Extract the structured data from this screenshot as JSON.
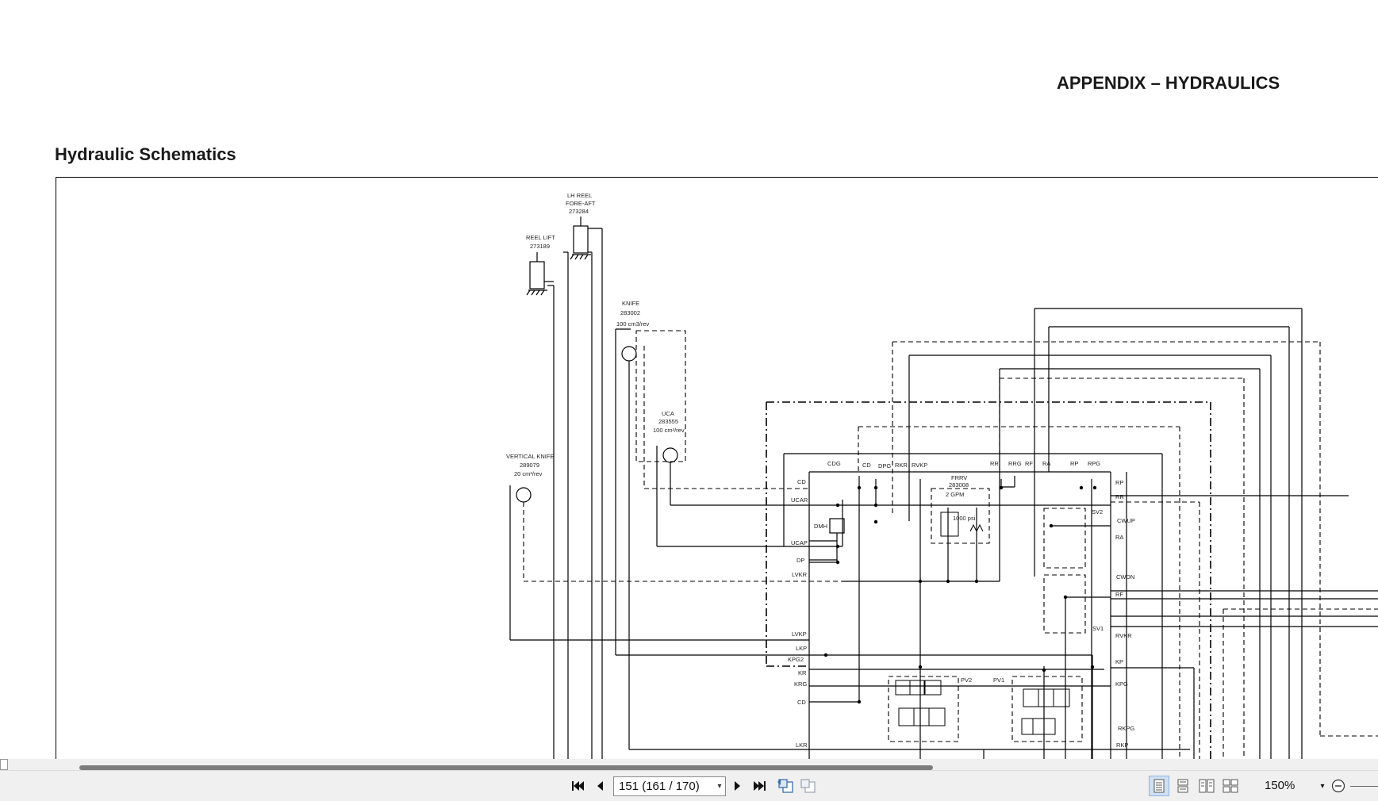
{
  "header": {
    "appendix_title": "APPENDIX – HYDRAULICS"
  },
  "section": {
    "title": "Hydraulic Schematics"
  },
  "schematic": {
    "components": {
      "lh_reel": {
        "line1": "LH REEL",
        "line2": "FORE-AFT",
        "part": "273284"
      },
      "reel_lift": {
        "line1": "REEL LIFT",
        "part": "273189"
      },
      "knife": {
        "line1": "KNIFE",
        "part": "283002",
        "disp": "100 cm3/rev"
      },
      "uca": {
        "line1": "UCA",
        "part": "283555",
        "disp": "100 cm³/rev"
      },
      "vertical_knife": {
        "line1": "VERTICAL KNIFE",
        "part": "289079",
        "disp": "20 cm³/rev"
      },
      "frrv": {
        "line1": "FRRV",
        "part": "283008",
        "flow": "2 GPM",
        "pressure": "1000 psi"
      },
      "dmh": "DMH",
      "sv1": "SV1",
      "sv2": "SV2",
      "pv1": "PV1",
      "pv2": "PV2"
    },
    "ports_top": [
      "CDG",
      "CD",
      "DPG",
      "RKR",
      "RVKP",
      "RR",
      "RRG",
      "RF",
      "RA",
      "RP",
      "RPG"
    ],
    "ports_left": [
      "CD",
      "UCAR",
      "UCAP",
      "DP",
      "LVKR",
      "LVKP",
      "LKP",
      "KPG2",
      "KR",
      "KRG",
      "CD",
      "LKR"
    ],
    "ports_right": [
      "RP",
      "RR",
      "CWUP",
      "RA",
      "CWDN",
      "RF",
      "RVKR",
      "KP",
      "KPG",
      "RKPG",
      "RKP"
    ]
  },
  "toolbar": {
    "first_page": "first-page-icon",
    "prev_page": "previous-page-icon",
    "page_value": "151 (161 / 170)",
    "next_page": "next-page-icon",
    "last_page": "last-page-icon",
    "zoom_value": "150%"
  }
}
